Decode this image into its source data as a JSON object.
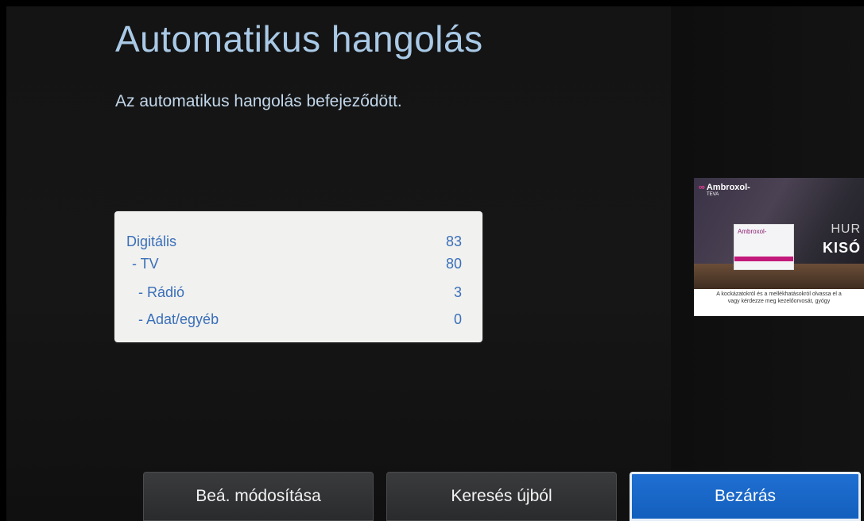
{
  "header": {
    "title": "Automatikus hangolás",
    "subtitle": "Az automatikus hangolás befejeződött."
  },
  "results": {
    "rows": [
      {
        "label": "Digitális",
        "value": "83"
      },
      {
        "label": "- TV",
        "value": "80"
      },
      {
        "label": "- Rádió",
        "value": "3"
      },
      {
        "label": "- Adat/egyéb",
        "value": "0"
      }
    ]
  },
  "preview": {
    "brand": "Ambroxol-",
    "brand_sub": "TEVA",
    "box_label": "Ambroxol-",
    "headline_1": "HUR",
    "headline_2": "KISÓ",
    "caption_1": "A kockázatokról és a mellékhatásokról olvassa el a",
    "caption_2": "vagy kérdezze meg kezelőorvosát, gyógy"
  },
  "buttons": {
    "change_settings": "Beá. módosítása",
    "search_again": "Keresés újból",
    "close": "Bezárás"
  },
  "colors": {
    "title": "#a9c9e6",
    "panel_text": "#3a6fb9",
    "button_primary": "#1a68c8"
  }
}
